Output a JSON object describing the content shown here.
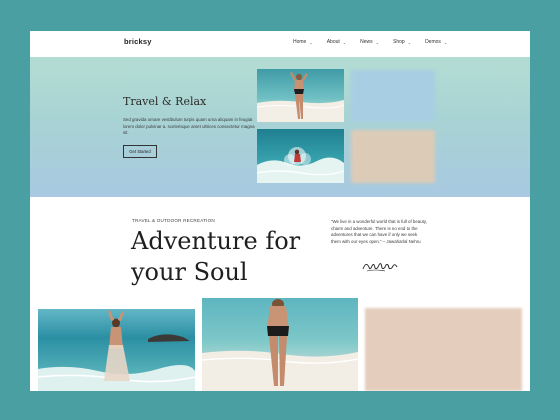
{
  "brand": {
    "logo": "bricksy"
  },
  "nav": [
    {
      "label": "Home"
    },
    {
      "label": "About"
    },
    {
      "label": "News"
    },
    {
      "label": "Shop"
    },
    {
      "label": "Demos"
    }
  ],
  "hero": {
    "title": "Travel & Relax",
    "text": "Sed gravida ornare vestibulum turpis quam urna aliquam in feugiat lorem dolor pulvinar a. scelerisque amet ultrices consectetur magna sit.",
    "button": "Get Started"
  },
  "section": {
    "eyebrow": "TRAVEL & OUTDOOR RECREATION",
    "title_line1": "Adventure for",
    "title_line2": "your Soul",
    "quote": "“We live in a wonderful world that is full of beauty, charm and adventure. There is no end to the adventures that we can have if only we seek them with our eyes open.” – Jawaharlal Nehru"
  },
  "colors": {
    "frame_bg": "#4a9fa2",
    "hero_top": "#b3ddd3",
    "hero_bottom": "#a8c9e1",
    "sand": "#dccbb7",
    "sky": "#a8cee3"
  }
}
